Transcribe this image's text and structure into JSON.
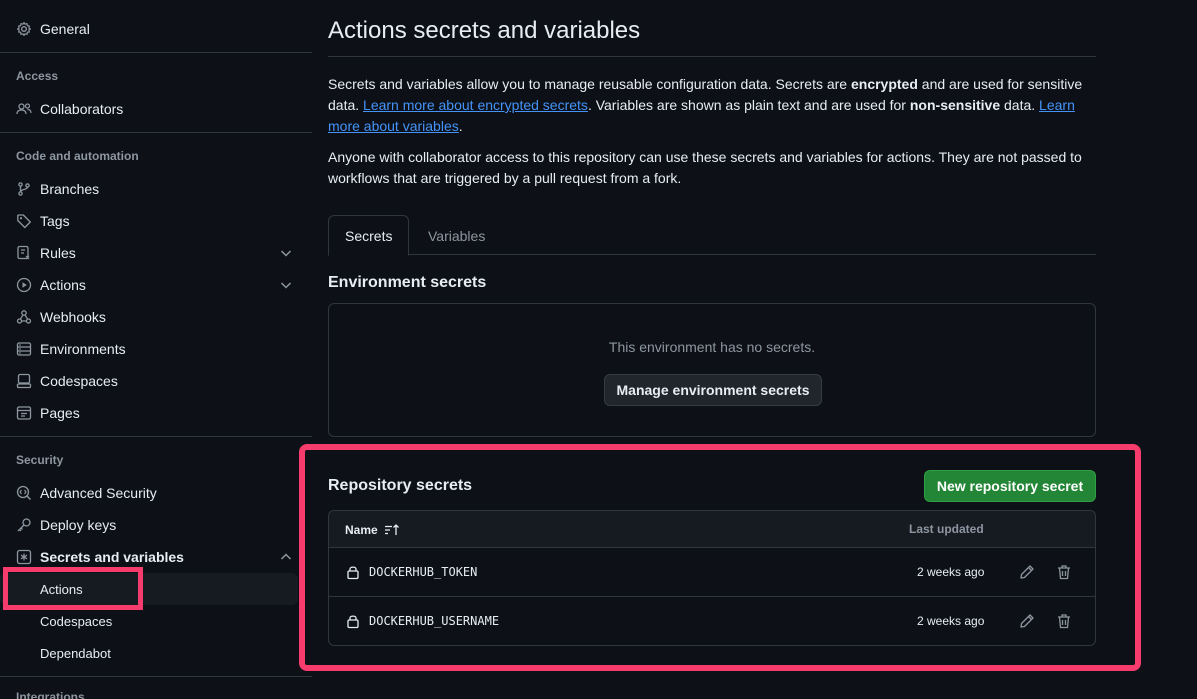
{
  "sidebar": {
    "general": "General",
    "groups": {
      "access": "Access",
      "code_automation": "Code and automation",
      "security": "Security",
      "integrations": "Integrations"
    },
    "items": {
      "collaborators": "Collaborators",
      "branches": "Branches",
      "tags": "Tags",
      "rules": "Rules",
      "actions": "Actions",
      "webhooks": "Webhooks",
      "environments": "Environments",
      "codespaces": "Codespaces",
      "pages": "Pages",
      "advanced_security": "Advanced Security",
      "deploy_keys": "Deploy keys",
      "secrets_variables": "Secrets and variables"
    },
    "sub_items": {
      "actions": "Actions",
      "codespaces": "Codespaces",
      "dependabot": "Dependabot"
    }
  },
  "main": {
    "title": "Actions secrets and variables",
    "intro": {
      "p1_a": "Secrets and variables allow you to manage reusable configuration data. Secrets are ",
      "p1_b": "encrypted",
      "p1_c": " and are used for sensitive data. ",
      "p1_link1": "Learn more about encrypted secrets",
      "p1_d": ". Variables are shown as plain text and are used for ",
      "p1_e": "non-sensitive",
      "p1_f": " data. ",
      "p1_link2": "Learn more about variables",
      "p1_g": ".",
      "p2": "Anyone with collaborator access to this repository can use these secrets and variables for actions. They are not passed to workflows that are triggered by a pull request from a fork."
    },
    "tabs": [
      "Secrets",
      "Variables"
    ],
    "environment": {
      "heading": "Environment secrets",
      "empty_text": "This environment has no secrets.",
      "manage_button": "Manage environment secrets"
    },
    "repository": {
      "heading": "Repository secrets",
      "new_button": "New repository secret",
      "col_name": "Name",
      "col_updated": "Last updated",
      "secrets": [
        {
          "name": "DOCKERHUB_TOKEN",
          "updated": "2 weeks ago"
        },
        {
          "name": "DOCKERHUB_USERNAME",
          "updated": "2 weeks ago"
        }
      ]
    }
  },
  "colors": {
    "background": "#0d1117",
    "border": "#30363d",
    "link": "#4493f8",
    "primary_button": "#238636",
    "highlight": "#f53c6d"
  }
}
